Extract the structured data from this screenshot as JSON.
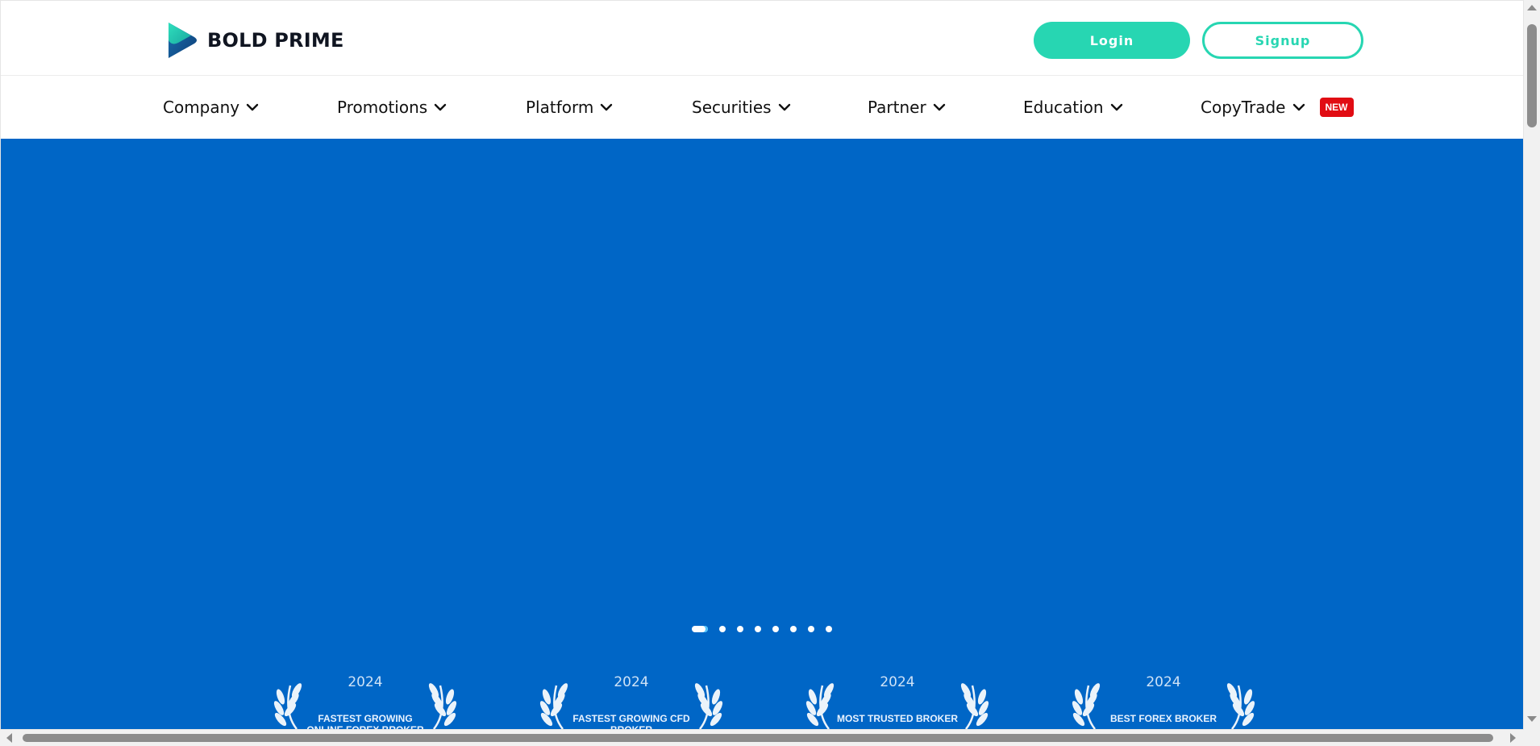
{
  "brand": {
    "name": "BOLD PRIME",
    "logo_icon": "bold-prime-logo-icon",
    "colors": {
      "accent": "#27d6b2",
      "hero_bg": "#0066c6",
      "badge": "#e10c13",
      "logo_dark": "#0d4a86"
    }
  },
  "header": {
    "login_label": "Login",
    "signup_label": "Signup"
  },
  "nav": {
    "items": [
      {
        "label": "Company",
        "icon": "chevron-down-icon"
      },
      {
        "label": "Promotions",
        "icon": "chevron-down-icon"
      },
      {
        "label": "Platform",
        "icon": "chevron-down-icon"
      },
      {
        "label": "Securities",
        "icon": "chevron-down-icon"
      },
      {
        "label": "Partner",
        "icon": "chevron-down-icon"
      },
      {
        "label": "Education",
        "icon": "chevron-down-icon"
      },
      {
        "label": "CopyTrade",
        "icon": "chevron-down-icon",
        "badge": "NEW"
      }
    ]
  },
  "hero": {
    "slider": {
      "total": 8,
      "active_index": 0
    },
    "awards": [
      {
        "year": "2024",
        "title": "FASTEST GROWING ONLINE FOREX BROKER"
      },
      {
        "year": "2024",
        "title": "FASTEST GROWING CFD BROKER"
      },
      {
        "year": "2024",
        "title": "MOST TRUSTED BROKER"
      },
      {
        "year": "2024",
        "title": "BEST FOREX BROKER"
      }
    ]
  }
}
